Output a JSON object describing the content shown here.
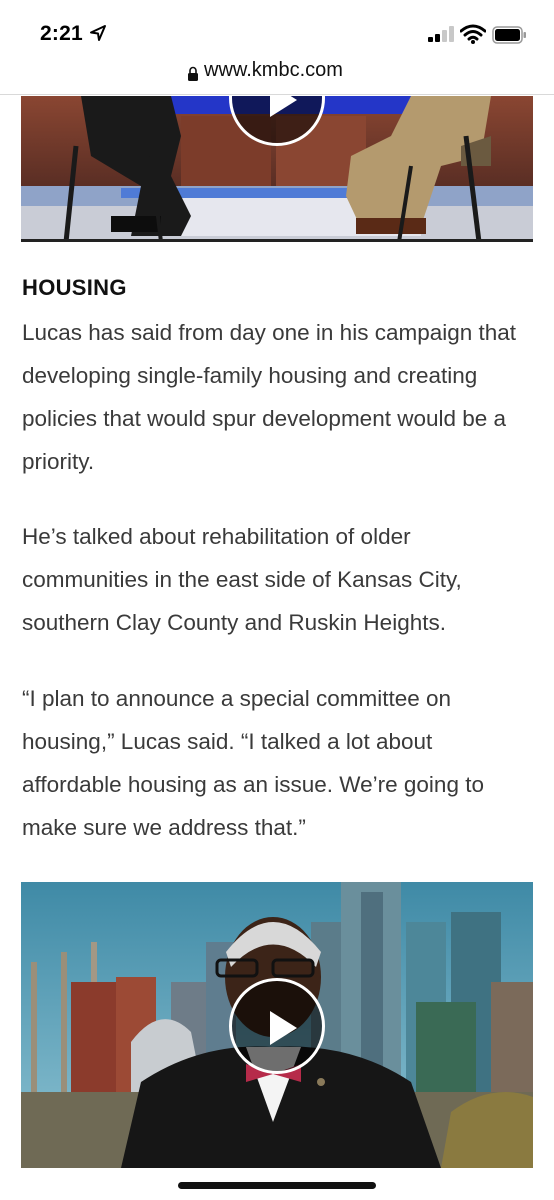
{
  "status_bar": {
    "time": "2:21"
  },
  "browser": {
    "url": "www.kmbc.com"
  },
  "article": {
    "section_heading": "HOUSING",
    "paragraphs": [
      "Lucas has said from day one in his campaign that developing single-family housing and creating policies that would spur development would be a priority.",
      "He’s talked about rehabilitation of older communities in the east side of Kansas City, southern Clay County and Ruskin Heights.",
      "“I plan to announce a special committee on housing,” Lucas said. “I talked a lot about affordable housing as an issue. We’re going to make sure we address that.”"
    ]
  },
  "icons": [
    "location-arrow-icon",
    "cellular-signal-icon",
    "wifi-icon",
    "battery-icon",
    "lock-icon",
    "play-icon"
  ]
}
